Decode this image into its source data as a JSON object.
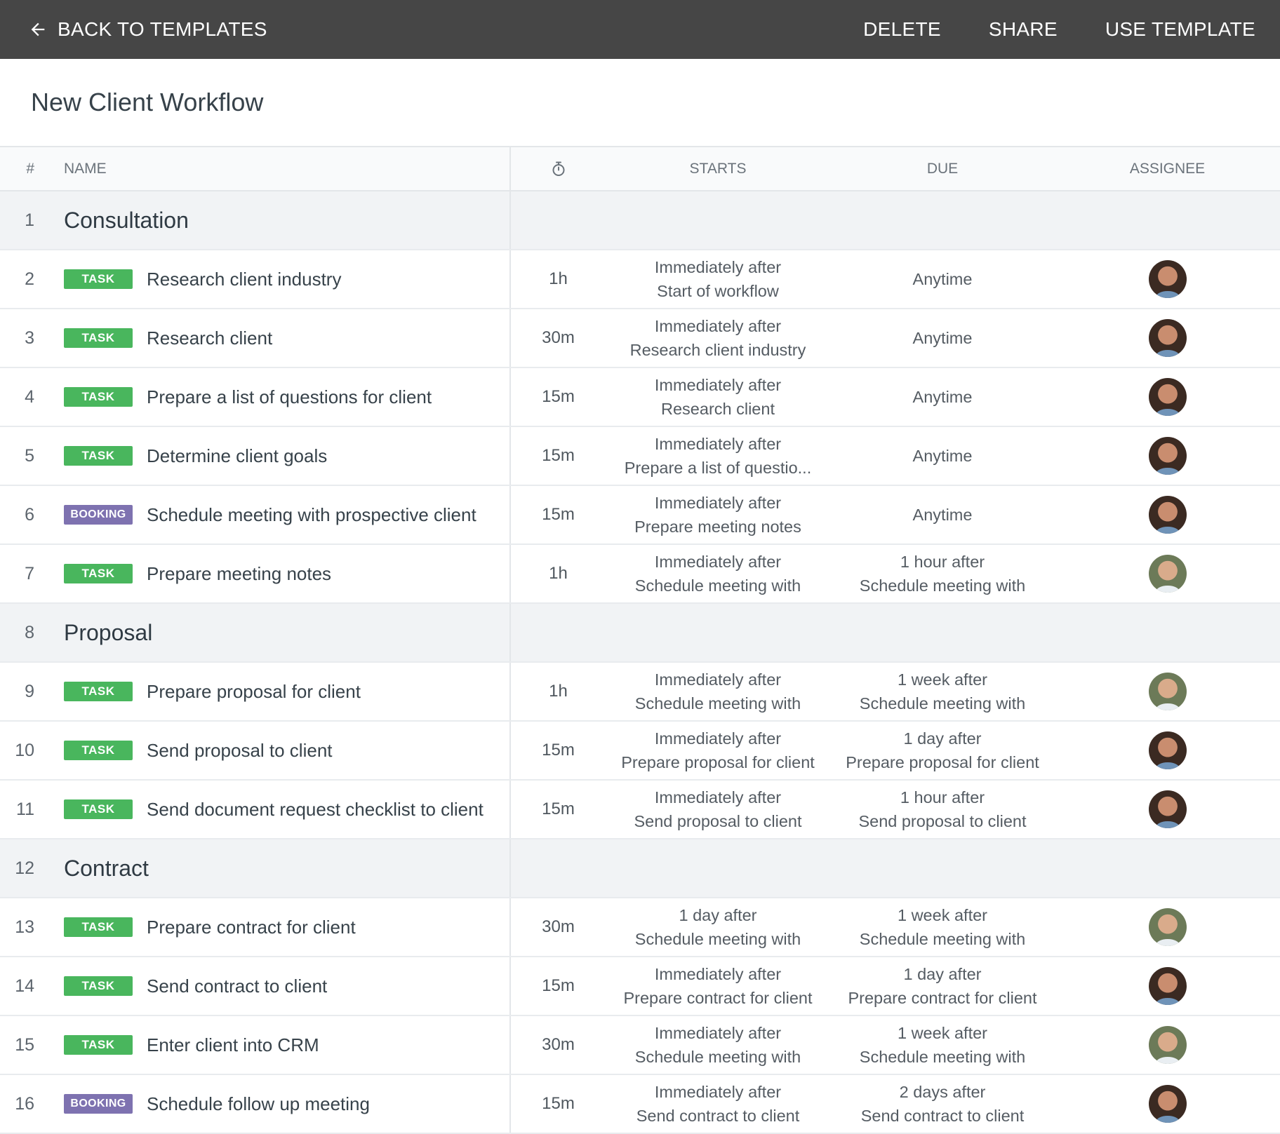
{
  "topbar": {
    "back_label": "BACK TO TEMPLATES",
    "delete_label": "DELETE",
    "share_label": "SHARE",
    "use_template_label": "USE TEMPLATE",
    "background": "#464646"
  },
  "page_title": "New Client Workflow",
  "table": {
    "headers": {
      "num": "#",
      "name": "NAME",
      "duration_icon": "timer-icon",
      "starts": "STARTS",
      "due": "DUE",
      "assignee": "ASSIGNEE"
    },
    "rows": [
      {
        "num": "1",
        "section": "Consultation"
      },
      {
        "num": "2",
        "badge": "TASK",
        "name": "Research client industry",
        "duration": "1h",
        "starts": [
          "Immediately after",
          "Start of workflow"
        ],
        "due": [
          "Anytime"
        ],
        "assignee": "dark"
      },
      {
        "num": "3",
        "badge": "TASK",
        "name": "Research client",
        "duration": "30m",
        "starts": [
          "Immediately after",
          "Research client industry"
        ],
        "due": [
          "Anytime"
        ],
        "assignee": "dark"
      },
      {
        "num": "4",
        "badge": "TASK",
        "name": "Prepare a list of questions for client",
        "duration": "15m",
        "starts": [
          "Immediately after",
          "Research client"
        ],
        "due": [
          "Anytime"
        ],
        "assignee": "dark"
      },
      {
        "num": "5",
        "badge": "TASK",
        "name": "Determine client goals",
        "duration": "15m",
        "starts": [
          "Immediately after",
          "Prepare a list of questio..."
        ],
        "due": [
          "Anytime"
        ],
        "assignee": "dark"
      },
      {
        "num": "6",
        "badge": "BOOKING",
        "name": "Schedule meeting with prospective client",
        "duration": "15m",
        "starts": [
          "Immediately after",
          "Prepare meeting notes"
        ],
        "due": [
          "Anytime"
        ],
        "assignee": "dark"
      },
      {
        "num": "7",
        "badge": "TASK",
        "name": "Prepare meeting notes",
        "duration": "1h",
        "starts": [
          "Immediately after",
          "Schedule meeting with"
        ],
        "due": [
          "1 hour after",
          "Schedule meeting with"
        ],
        "assignee": "light"
      },
      {
        "num": "8",
        "section": "Proposal"
      },
      {
        "num": "9",
        "badge": "TASK",
        "name": "Prepare proposal for client",
        "duration": "1h",
        "starts": [
          "Immediately after",
          "Schedule meeting with"
        ],
        "due": [
          "1 week after",
          "Schedule meeting with"
        ],
        "assignee": "light"
      },
      {
        "num": "10",
        "badge": "TASK",
        "name": "Send proposal to client",
        "duration": "15m",
        "starts": [
          "Immediately after",
          "Prepare proposal for client"
        ],
        "due": [
          "1 day after",
          "Prepare proposal for client"
        ],
        "assignee": "dark"
      },
      {
        "num": "11",
        "badge": "TASK",
        "name": "Send document request checklist to client",
        "duration": "15m",
        "starts": [
          "Immediately after",
          "Send proposal to client"
        ],
        "due": [
          "1 hour after",
          "Send proposal to client"
        ],
        "assignee": "dark"
      },
      {
        "num": "12",
        "section": "Contract"
      },
      {
        "num": "13",
        "badge": "TASK",
        "name": "Prepare contract for client",
        "duration": "30m",
        "starts": [
          "1 day after",
          "Schedule meeting with"
        ],
        "due": [
          "1 week after",
          "Schedule meeting with"
        ],
        "assignee": "light"
      },
      {
        "num": "14",
        "badge": "TASK",
        "name": "Send contract to client",
        "duration": "15m",
        "starts": [
          "Immediately after",
          "Prepare contract for client"
        ],
        "due": [
          "1 day after",
          "Prepare contract for client"
        ],
        "assignee": "dark"
      },
      {
        "num": "15",
        "badge": "TASK",
        "name": "Enter client into CRM",
        "duration": "30m",
        "starts": [
          "Immediately after",
          "Schedule meeting with"
        ],
        "due": [
          "1 week after",
          "Schedule meeting with"
        ],
        "assignee": "light"
      },
      {
        "num": "16",
        "badge": "BOOKING",
        "name": "Schedule follow up meeting",
        "duration": "15m",
        "starts": [
          "Immediately after",
          "Send contract to client"
        ],
        "due": [
          "2 days after",
          "Send contract to client"
        ],
        "assignee": "dark"
      }
    ]
  },
  "colors": {
    "task_badge": "#49b65d",
    "booking_badge": "#7e72b0",
    "section_bg": "#f1f3f5"
  }
}
